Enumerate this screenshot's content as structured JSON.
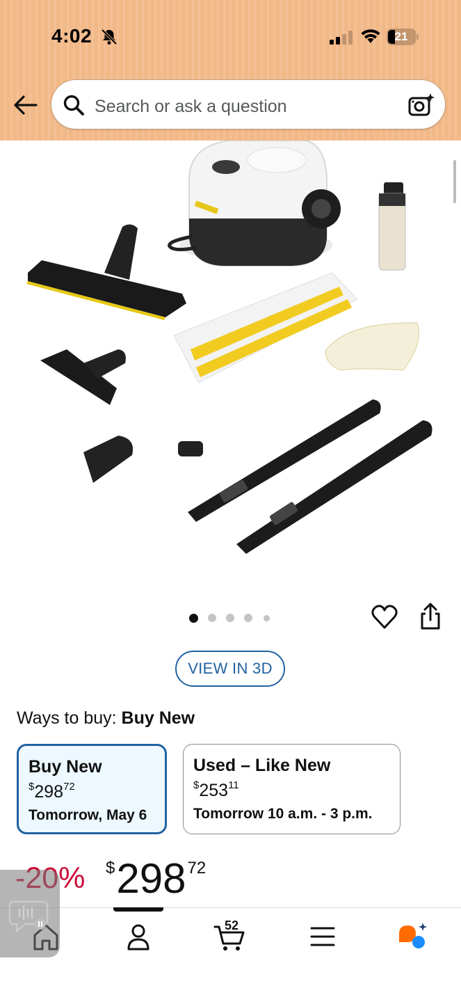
{
  "status_bar": {
    "time": "4:02",
    "battery": "21"
  },
  "search": {
    "placeholder": "Search or ask a question"
  },
  "gallery": {
    "page_count": 5,
    "current_page": 1
  },
  "view_3d": {
    "label": "VIEW IN 3D"
  },
  "ways_to_buy": {
    "prefix": "Ways to buy:",
    "selected": "Buy New"
  },
  "options": [
    {
      "title": "Buy New",
      "currency": "$",
      "price_whole": "298",
      "price_cents": "72",
      "delivery": "Tomorrow, May 6"
    },
    {
      "title": "Used – Like New",
      "currency": "$",
      "price_whole": "253",
      "price_cents": "11",
      "delivery": "Tomorrow 10 a.m. - 3 p.m."
    }
  ],
  "price": {
    "discount": "-20%",
    "currency": "$",
    "whole": "298",
    "cents": "72"
  },
  "nav": {
    "cart_count": "52"
  },
  "colors": {
    "header": "#f2b988",
    "accent": "#2162a1",
    "deal": "#cc0c39",
    "selected_bg": "#edf8ff"
  }
}
